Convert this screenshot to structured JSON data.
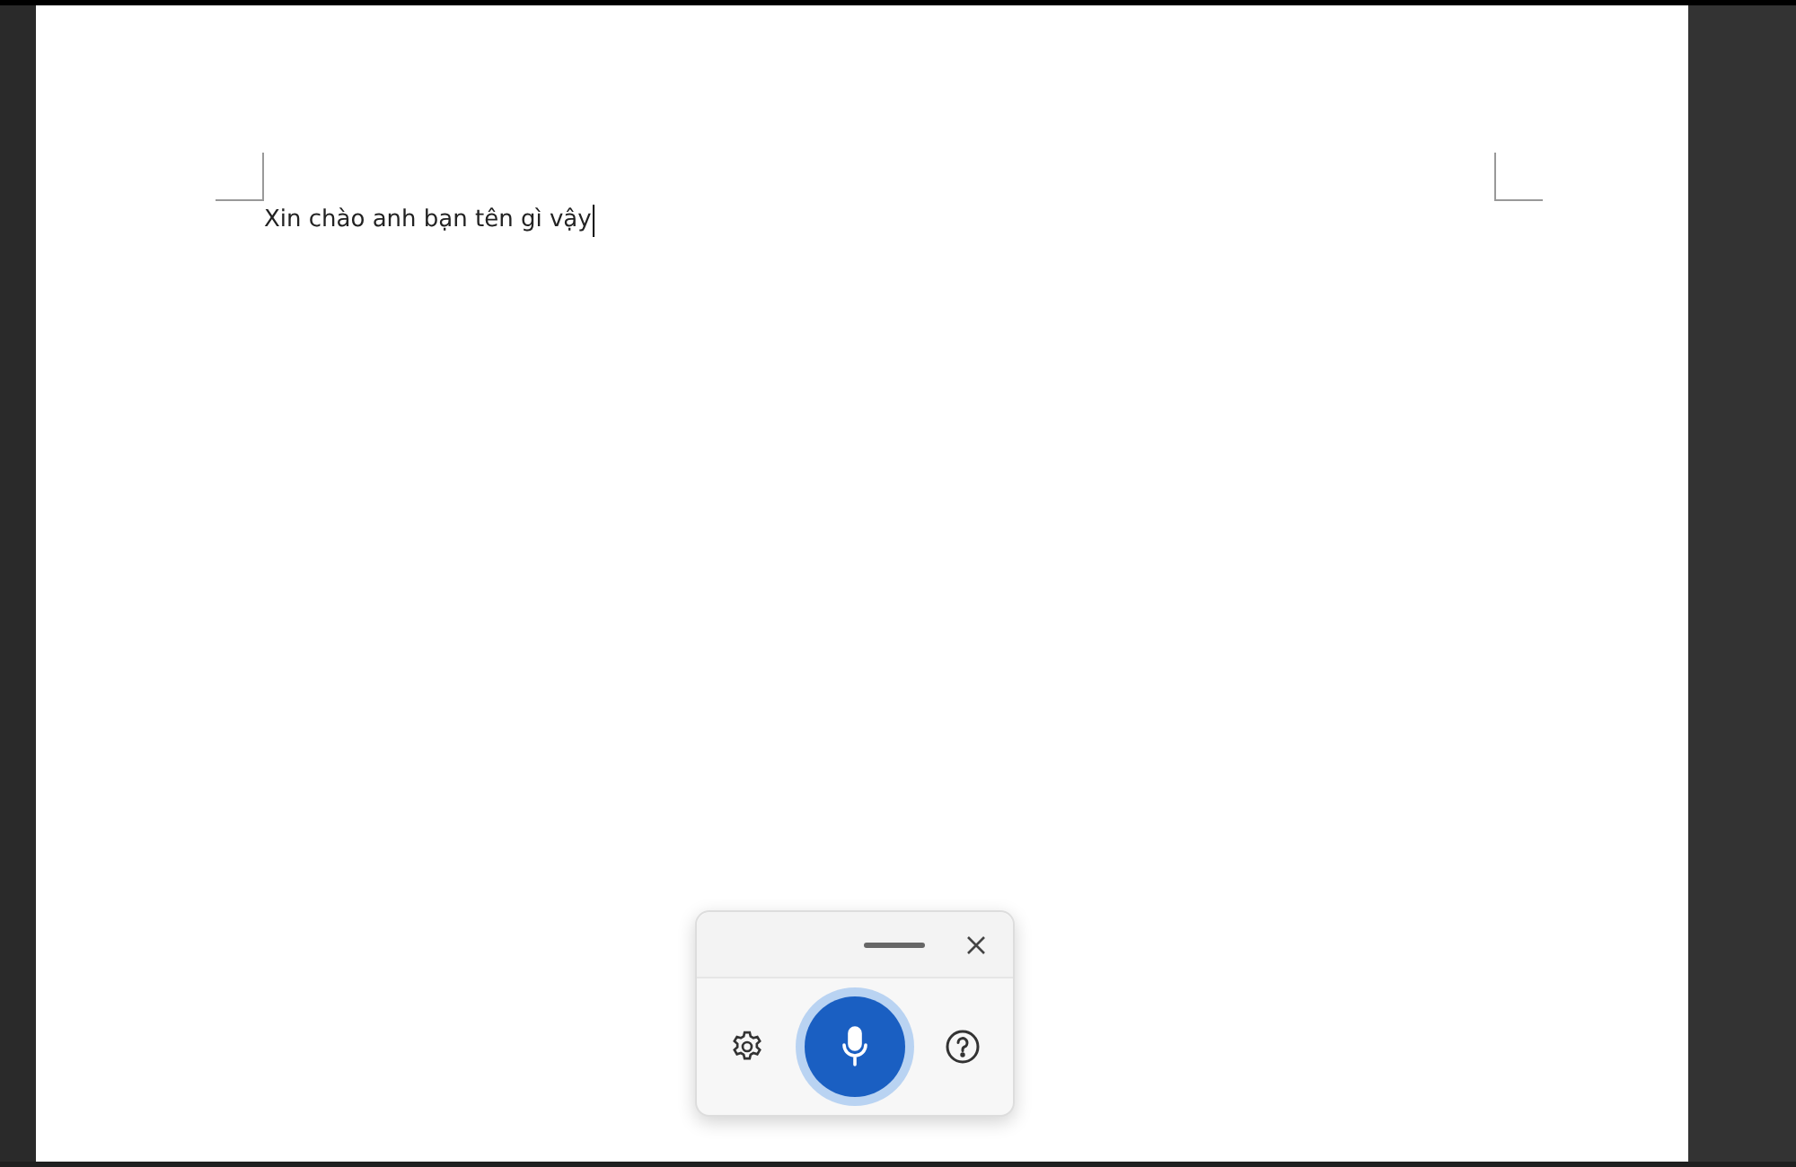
{
  "document": {
    "text": "Xin chào anh bạn tên gì vậy",
    "cursor": true
  },
  "voice_typing": {
    "listening": true
  }
}
